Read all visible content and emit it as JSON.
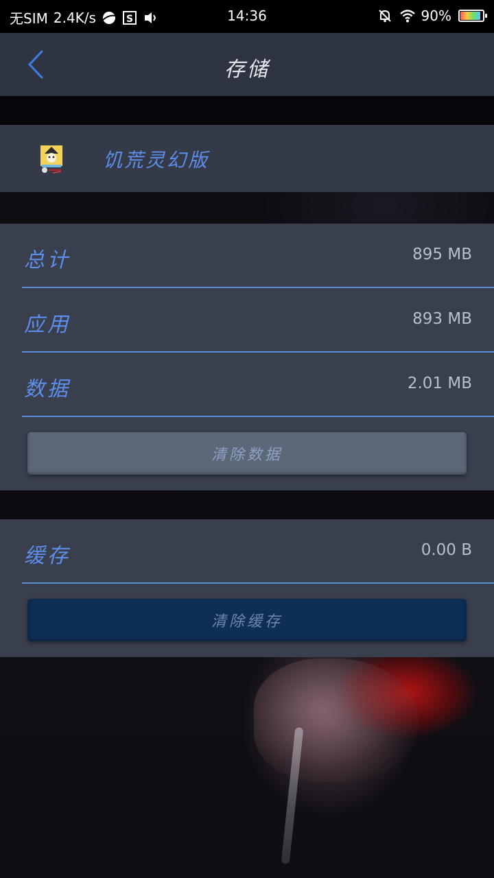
{
  "status_bar": {
    "sim": "无SIM",
    "speed": "2.4K/s",
    "time": "14:36",
    "battery": "90%",
    "battery_level": 0.9
  },
  "header": {
    "title": "存储"
  },
  "app": {
    "name": "饥荒灵幻版"
  },
  "storage": {
    "total_label": "总计",
    "total_value": "895 MB",
    "app_label": "应用",
    "app_value": "893 MB",
    "data_label": "数据",
    "data_value": "2.01 MB",
    "clear_data_label": "清除数据"
  },
  "cache": {
    "label": "缓存",
    "value": "0.00 B",
    "clear_cache_label": "清除缓存"
  },
  "colors": {
    "accent": "#5d8eea",
    "panel": "#3a3f4d",
    "header": "#2f3442"
  }
}
